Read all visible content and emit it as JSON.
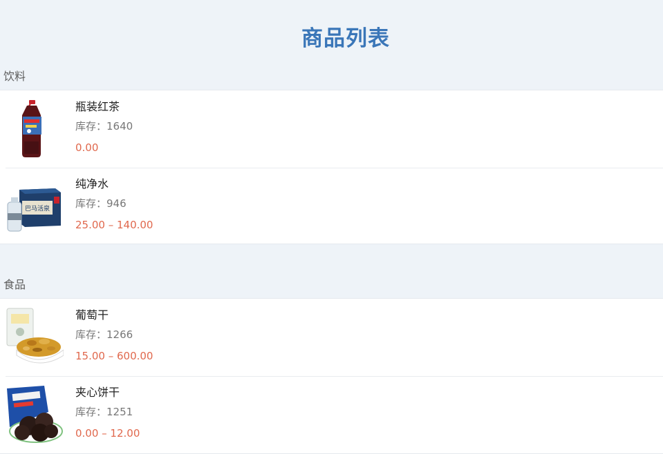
{
  "header": {
    "title": "商品列表"
  },
  "sections": [
    {
      "label": "饮料",
      "products": [
        {
          "name": "瓶装红茶",
          "stock": "库存：1640",
          "price": "0.00",
          "image": "bottled-tea-image"
        },
        {
          "name": "纯净水",
          "stock": "库存：946",
          "price": "25.00 – 140.00",
          "image": "water-box-image",
          "box_text": "巴马活泉"
        }
      ]
    },
    {
      "label": "食品",
      "products": [
        {
          "name": "葡萄干",
          "stock": "库存：1266",
          "price": "15.00 – 600.00",
          "image": "raisins-image"
        },
        {
          "name": "夹心饼干",
          "stock": "库存：1251",
          "price": "0.00 – 12.00",
          "image": "sandwich-cookies-image"
        }
      ]
    }
  ],
  "colors": {
    "title": "#3a76b8",
    "price": "#e0684d",
    "background": "#eef3f8"
  }
}
